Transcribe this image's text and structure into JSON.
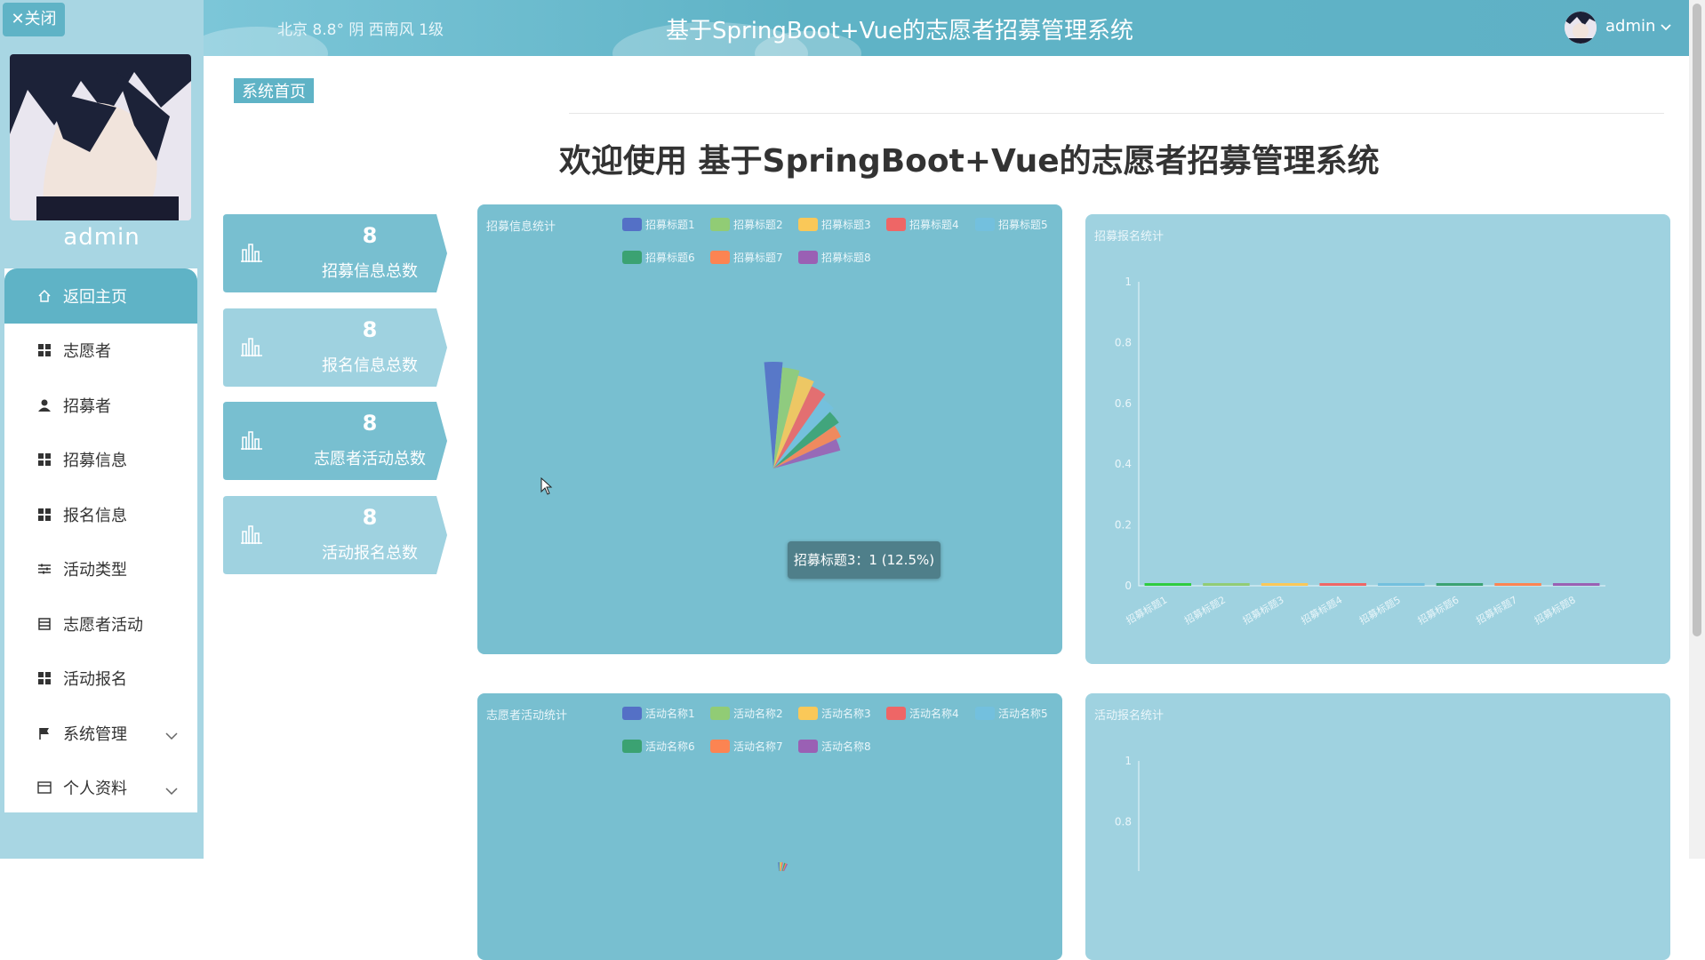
{
  "sidebar": {
    "close_label": "✕关闭",
    "username": "admin",
    "items": [
      {
        "label": "返回主页",
        "icon": "home-icon"
      },
      {
        "label": "志愿者",
        "icon": "grid-icon"
      },
      {
        "label": "招募者",
        "icon": "user-icon"
      },
      {
        "label": "招募信息",
        "icon": "grid-icon"
      },
      {
        "label": "报名信息",
        "icon": "grid-icon"
      },
      {
        "label": "活动类型",
        "icon": "sliders-icon"
      },
      {
        "label": "志愿者活动",
        "icon": "list-icon"
      },
      {
        "label": "活动报名",
        "icon": "grid-icon"
      },
      {
        "label": "系统管理",
        "icon": "flag-icon"
      },
      {
        "label": "个人资料",
        "icon": "card-icon"
      }
    ]
  },
  "header": {
    "weather": "北京  8.8°  阴  西南风  1级",
    "title": "基于SpringBoot+Vue的志愿者招募管理系统",
    "user": "admin"
  },
  "breadcrumb": "系统首页",
  "welcome": "欢迎使用 基于SpringBoot+Vue的志愿者招募管理系统",
  "stats": [
    {
      "value": "8",
      "label": "招募信息总数"
    },
    {
      "value": "8",
      "label": "报名信息总数"
    },
    {
      "value": "8",
      "label": "志愿者活动总数"
    },
    {
      "value": "8",
      "label": "活动报名总数"
    }
  ],
  "chart_data": [
    {
      "type": "pie",
      "title": "招募信息统计",
      "categories": [
        "招募标题1",
        "招募标题2",
        "招募标题3",
        "招募标题4",
        "招募标题5",
        "招募标题6",
        "招募标题7",
        "招募标题8"
      ],
      "values": [
        1,
        1,
        1,
        1,
        1,
        1,
        1,
        1
      ],
      "colors": [
        "#5470c6",
        "#91cc75",
        "#fac858",
        "#ee6666",
        "#73c0de",
        "#3ba272",
        "#fc8452",
        "#9a60b4"
      ],
      "tooltip": "招募标题3：1 (12.5%)"
    },
    {
      "type": "bar",
      "title": "招募报名统计",
      "categories": [
        "招募标题1",
        "招募标题2",
        "招募标题3",
        "招募标题4",
        "招募标题5",
        "招募标题6",
        "招募标题7",
        "招募标题8"
      ],
      "values": [
        0,
        0,
        0,
        0,
        0,
        0,
        0,
        0
      ],
      "ylim": [
        0,
        1
      ],
      "yticks": [
        "0",
        "0.2",
        "0.4",
        "0.6",
        "0.8",
        "1"
      ],
      "colors": [
        "#2ecc40",
        "#91cc75",
        "#fac858",
        "#ee6666",
        "#73c0de",
        "#3ba272",
        "#fc8452",
        "#9a60b4"
      ]
    },
    {
      "type": "pie",
      "title": "志愿者活动统计",
      "categories": [
        "活动名称1",
        "活动名称2",
        "活动名称3",
        "活动名称4",
        "活动名称5",
        "活动名称6",
        "活动名称7",
        "活动名称8"
      ],
      "colors": [
        "#5470c6",
        "#91cc75",
        "#fac858",
        "#ee6666",
        "#73c0de",
        "#3ba272",
        "#fc8452",
        "#9a60b4"
      ]
    },
    {
      "type": "bar",
      "title": "活动报名统计",
      "ylim": [
        0,
        1
      ],
      "yticks": [
        "1",
        "0.8"
      ]
    }
  ]
}
